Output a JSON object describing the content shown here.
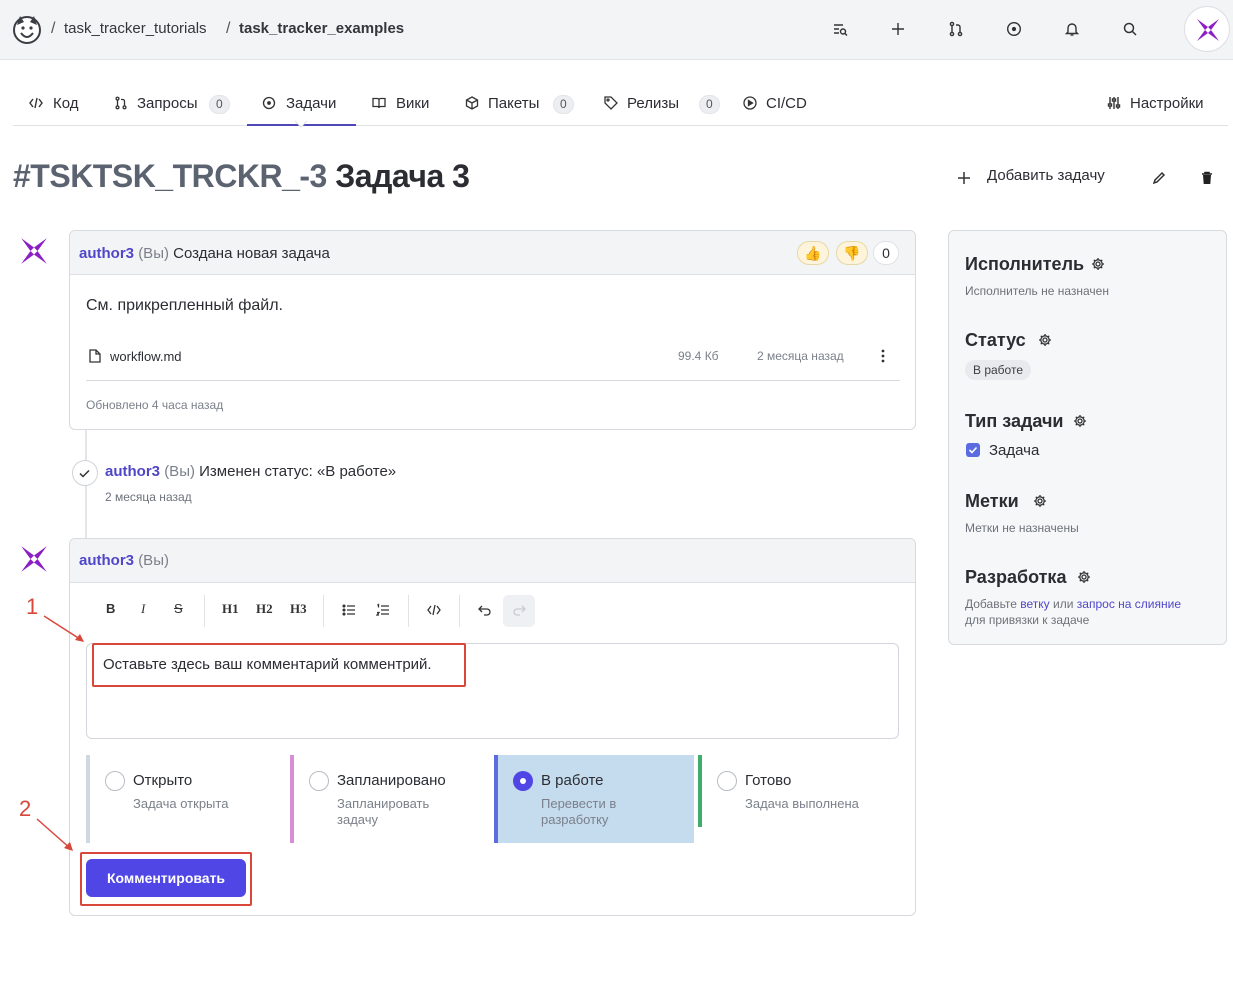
{
  "breadcrumb": {
    "org": "task_tracker_tutorials",
    "repo": "task_tracker_examples",
    "sep": "/"
  },
  "tabs": [
    {
      "label": "Код",
      "icon": "code-icon"
    },
    {
      "label": "Запросы",
      "count": "0",
      "icon": "pull-request-icon"
    },
    {
      "label": "Задачи",
      "icon": "issue-icon",
      "active": true
    },
    {
      "label": "Вики",
      "icon": "book-icon"
    },
    {
      "label": "Пакеты",
      "count": "0",
      "icon": "package-icon"
    },
    {
      "label": "Релизы",
      "count": "0",
      "icon": "tag-icon"
    },
    {
      "label": "CI/CD",
      "icon": "play-icon"
    },
    {
      "label": "Настройки",
      "icon": "settings-icon"
    }
  ],
  "issue": {
    "id": "#TSKTSK_TRCKR_-3",
    "title": "Задача 3"
  },
  "header_actions": {
    "add_issue": "Добавить задачу"
  },
  "comment1": {
    "author": "author3",
    "you": "(Вы)",
    "action": "Создана новая задача",
    "body": "См. прикрепленный файл.",
    "reactions": {
      "count": "0"
    },
    "attachment": {
      "name": "workflow.md",
      "size": "99.4 Кб",
      "date": "2 месяца назад"
    },
    "updated": "Обновлено 4 часа назад"
  },
  "event": {
    "author": "author3",
    "you": "(Вы)",
    "text": "Изменен статус: «В работе»",
    "time": "2 месяца назад"
  },
  "new_comment": {
    "author": "author3",
    "you": "(Вы)",
    "toolbar": [
      "B",
      "I",
      "S",
      "H1",
      "H2",
      "H3"
    ],
    "text": "Оставьте здесь ваш комментарий комментрий.",
    "submit": "Комментировать"
  },
  "statuses": [
    {
      "label": "Открыто",
      "desc": "Задача открыта",
      "color": "#cfd8e3",
      "selected": false
    },
    {
      "label": "Запланировано",
      "desc": "Запланировать задачу",
      "color": "#d48fd6",
      "selected": false
    },
    {
      "label": "В работе",
      "desc": "Перевести в разработку",
      "color": "#5b6be0",
      "selected": true
    },
    {
      "label": "Готово",
      "desc": "Задача выполнена",
      "color": "#3fae6a",
      "selected": false
    }
  ],
  "annotations": [
    "1",
    "2"
  ],
  "sidebar": {
    "assignee": {
      "title": "Исполнитель",
      "value": "Исполнитель не назначен"
    },
    "status": {
      "title": "Статус",
      "value": "В работе"
    },
    "type": {
      "title": "Тип задачи",
      "value": "Задача"
    },
    "labels": {
      "title": "Метки",
      "value": "Метки не назначены"
    },
    "dev": {
      "title": "Разработка",
      "text1": "Добавьте",
      "link1": "ветку",
      "text2": "или",
      "link2": "запрос на слияние",
      "text3": "для привязки к задаче"
    }
  },
  "colors": {
    "accent": "#4f46e5",
    "author": "#5046c8",
    "annotation": "#d9473b"
  }
}
